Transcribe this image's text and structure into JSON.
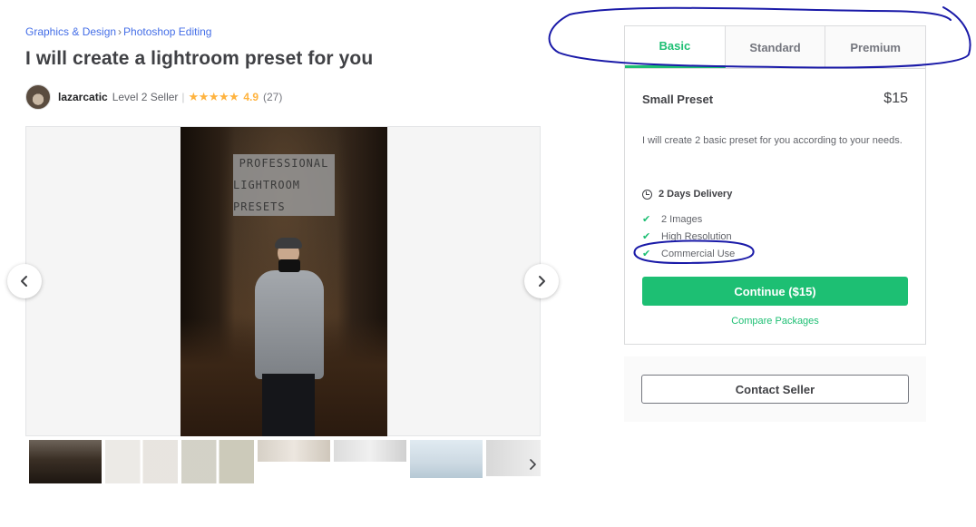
{
  "breadcrumb": {
    "category": "Graphics & Design",
    "separator": "›",
    "subcategory": "Photoshop Editing"
  },
  "gig": {
    "title": "I will create a lightroom preset for you"
  },
  "seller": {
    "username": "lazarcatic",
    "level": "Level 2 Seller",
    "divider": "|",
    "stars": "★★★★★",
    "rating": "4.9",
    "reviews": "(27)"
  },
  "gallery": {
    "overlay_line1": "PROFESSIONAL",
    "overlay_line2": "LIGHTROOM PRESETS",
    "thumbnail_more_icon": "chevron-right-icon"
  },
  "packages": {
    "tabs": [
      {
        "label": "Basic",
        "active": true
      },
      {
        "label": "Standard",
        "active": false
      },
      {
        "label": "Premium",
        "active": false
      }
    ],
    "selected": {
      "name": "Small Preset",
      "price": "$15",
      "description": "I will create 2 basic preset for you according to your needs.",
      "delivery": "2 Days Delivery",
      "features": [
        "2 Images",
        "High Resolution",
        "Commercial Use"
      ],
      "continue_label": "Continue ($15)",
      "compare_label": "Compare Packages"
    }
  },
  "contact": {
    "button_label": "Contact Seller"
  },
  "colors": {
    "accent_green": "#1dbf73",
    "link_blue": "#446ee7",
    "star_gold": "#ffb33e",
    "annotation_ink": "#1a1aa8"
  }
}
